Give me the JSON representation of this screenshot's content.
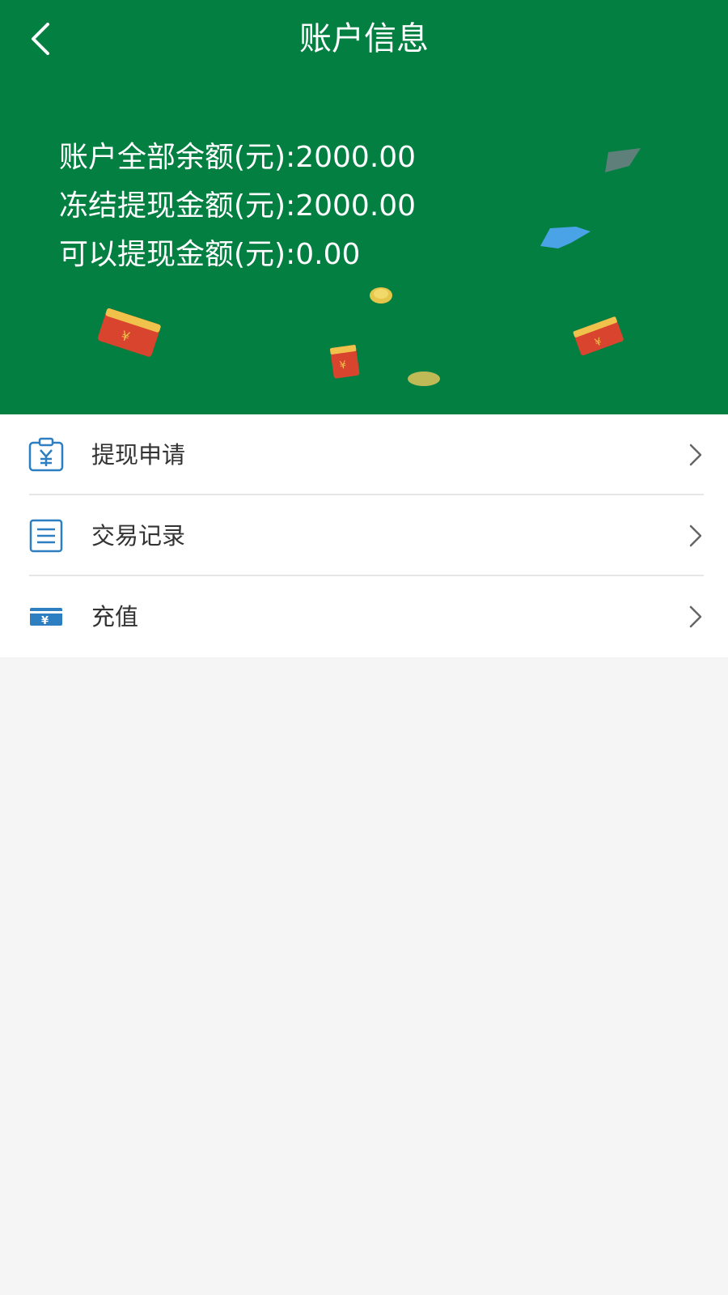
{
  "header": {
    "title": "账户信息",
    "back_icon": "chevron-left-icon"
  },
  "balances": {
    "total": "账户全部余额(元):2000.00",
    "frozen": "冻结提现金额(元):2000.00",
    "available": "可以提现金额(元):0.00"
  },
  "menu": {
    "items": [
      {
        "label": "提现申请",
        "icon": "withdraw-clipboard-icon"
      },
      {
        "label": "交易记录",
        "icon": "list-document-icon"
      },
      {
        "label": "充值",
        "icon": "recharge-card-icon"
      }
    ]
  },
  "colors": {
    "header_bg": "#027f41",
    "icon_blue": "#2d7fc2",
    "page_bg": "#f5f5f5",
    "chevron": "#666666"
  }
}
